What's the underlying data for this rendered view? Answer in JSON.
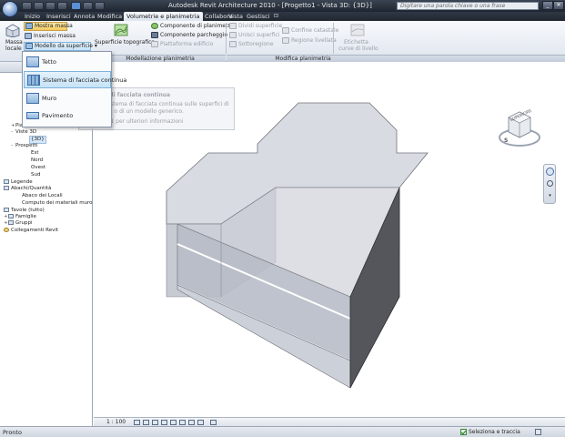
{
  "window": {
    "title": "Autodesk Revit Architecture 2010 - [Progetto1 - Vista 3D: {3D}]",
    "search_placeholder": "Digitare una parola chiave o una frase",
    "close_glyph": "✕"
  },
  "tabs": [
    {
      "label": "Inizio",
      "active": false
    },
    {
      "label": "Inserisci",
      "active": false
    },
    {
      "label": "Annota",
      "active": false
    },
    {
      "label": "Modifica",
      "active": false
    },
    {
      "label": "Volumetrie e planimetria",
      "active": true
    },
    {
      "label": "Collabora",
      "active": false
    },
    {
      "label": "Vista",
      "active": false
    },
    {
      "label": "Gestisci",
      "active": false
    }
  ],
  "ribbon": {
    "massa_locale": {
      "line1": "Massa",
      "line2": "locale"
    },
    "mostra_massa": "Mostra massa",
    "inserisci_massa": "Inserisci massa",
    "modello_superficie": "Modello da superficie",
    "superficie_topografica": "Superficie topografica",
    "componente_planimetria": "Componente di planimetria",
    "componente_parcheggio": "Componente parcheggio",
    "piattaforma_edificio": "Piattaforma edificio",
    "divisi_superficie": "Dividi superficie",
    "unisci_superfici": "Unisci superfici",
    "sottoregione": "Sottoregione",
    "confine_catastale": "Confine catastale",
    "regione_livellata": "Regione livellata",
    "etichetta": {
      "line1": "Etichetta",
      "line2": "curve di livello"
    },
    "panel_modellazione": "Modellazione planimetria",
    "panel_modifica": "Modifica planimetria"
  },
  "menu": {
    "items": [
      {
        "label": "Tetto",
        "hover": false
      },
      {
        "label": "Sistema di facciata continua",
        "hover": true
      },
      {
        "label": "Muro",
        "hover": false
      },
      {
        "label": "Pavimento",
        "hover": false
      }
    ]
  },
  "tooltip": {
    "title": "Sistema di facciata continua",
    "body": "Crea un sistema di facciata continua sulle superfici di una massa o di un modello generico.",
    "help": "Premere F1 per ulteriori informazioni"
  },
  "browser": {
    "items": [
      {
        "label": "Piante del controsoffitto",
        "indent": 1,
        "twisty": "+"
      },
      {
        "label": "Viste 3D",
        "indent": 1,
        "twisty": "-"
      },
      {
        "label": "{3D}",
        "indent": 2,
        "twisty": "",
        "selected": true
      },
      {
        "label": "Prospetti",
        "indent": 1,
        "twisty": "-"
      },
      {
        "label": "Est",
        "indent": 2,
        "twisty": ""
      },
      {
        "label": "Nord",
        "indent": 2,
        "twisty": ""
      },
      {
        "label": "Ovest",
        "indent": 2,
        "twisty": ""
      },
      {
        "label": "Sud",
        "indent": 2,
        "twisty": ""
      },
      {
        "label": "Legende",
        "indent": 0,
        "twisty": "",
        "icon": true
      },
      {
        "label": "Abachi/Quantità",
        "indent": 0,
        "twisty": "-",
        "icon": true
      },
      {
        "label": "Abaco dei Locali",
        "indent": 1,
        "twisty": ""
      },
      {
        "label": "Computo dei materiali muro",
        "indent": 1,
        "twisty": ""
      },
      {
        "label": "Tavole (tutto)",
        "indent": 0,
        "twisty": "",
        "icon": true
      },
      {
        "label": "Famiglie",
        "indent": 0,
        "twisty": "+",
        "icon": true
      },
      {
        "label": "Gruppi",
        "indent": 0,
        "twisty": "+",
        "icon": true
      },
      {
        "label": "Collegamenti Revit",
        "indent": 0,
        "twisty": "",
        "icon": true
      }
    ]
  },
  "viewcube": {
    "face": "SUPERIORE",
    "compass": "S"
  },
  "viewbar": {
    "scale": "1 : 100"
  },
  "status": {
    "text": "Pronto",
    "select_track": "Seleziona e traccia"
  },
  "colors": {
    "massing_fill": "#c9ccd6",
    "massing_side": "#55565c",
    "hover_blue": "#c6e3f7"
  }
}
